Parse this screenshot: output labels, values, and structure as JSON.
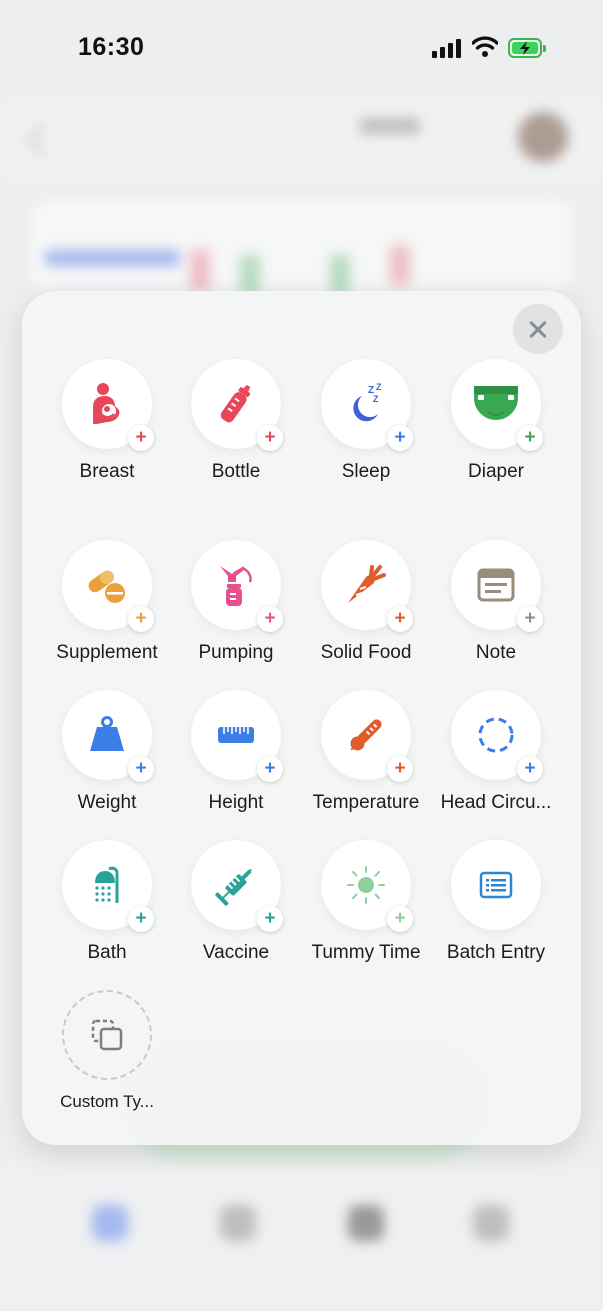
{
  "status_bar": {
    "time": "16:30"
  },
  "colors": {
    "red": "#e8475b",
    "pink": "#e84f8f",
    "blue": "#3d7ee6",
    "green": "#38a852",
    "orange": "#e9a23b",
    "brown": "#9a8d7d",
    "teal": "#29a39a"
  },
  "actions": [
    {
      "label": "Breast",
      "icon": "breastfeeding-icon",
      "plus_color": "#e8475b"
    },
    {
      "label": "Bottle",
      "icon": "bottle-icon",
      "plus_color": "#e8475b"
    },
    {
      "label": "Sleep",
      "icon": "moon-sleep-icon",
      "plus_color": "#3d7ee6"
    },
    {
      "label": "Diaper",
      "icon": "diaper-icon",
      "plus_color": "#38a852"
    },
    {
      "label": "Supplement",
      "icon": "pills-icon",
      "plus_color": "#e9a23b"
    },
    {
      "label": "Pumping",
      "icon": "breast-pump-icon",
      "plus_color": "#e84f8f"
    },
    {
      "label": "Solid Food",
      "icon": "carrot-icon",
      "plus_color": "#e05d2a"
    },
    {
      "label": "Note",
      "icon": "note-icon",
      "plus_color": "#9a8d7d"
    },
    {
      "label": "Weight",
      "icon": "weight-icon",
      "plus_color": "#3d7ee6"
    },
    {
      "label": "Height",
      "icon": "ruler-icon",
      "plus_color": "#3d7ee6"
    },
    {
      "label": "Temperature",
      "icon": "thermometer-icon",
      "plus_color": "#e05d2a"
    },
    {
      "label": "Head Circu...",
      "icon": "head-circumference-icon",
      "plus_color": "#3d7ee6"
    },
    {
      "label": "Bath",
      "icon": "shower-icon",
      "plus_color": "#29a39a"
    },
    {
      "label": "Vaccine",
      "icon": "syringe-icon",
      "plus_color": "#29a39a"
    },
    {
      "label": "Tummy Time",
      "icon": "sun-icon",
      "plus_color": "#8fcf9c"
    },
    {
      "label": "Batch Entry",
      "icon": "list-icon",
      "plus_color": ""
    },
    {
      "label": "Custom Ty...",
      "icon": "custom-type-icon",
      "plus_color": ""
    }
  ],
  "plus_symbol": "+"
}
